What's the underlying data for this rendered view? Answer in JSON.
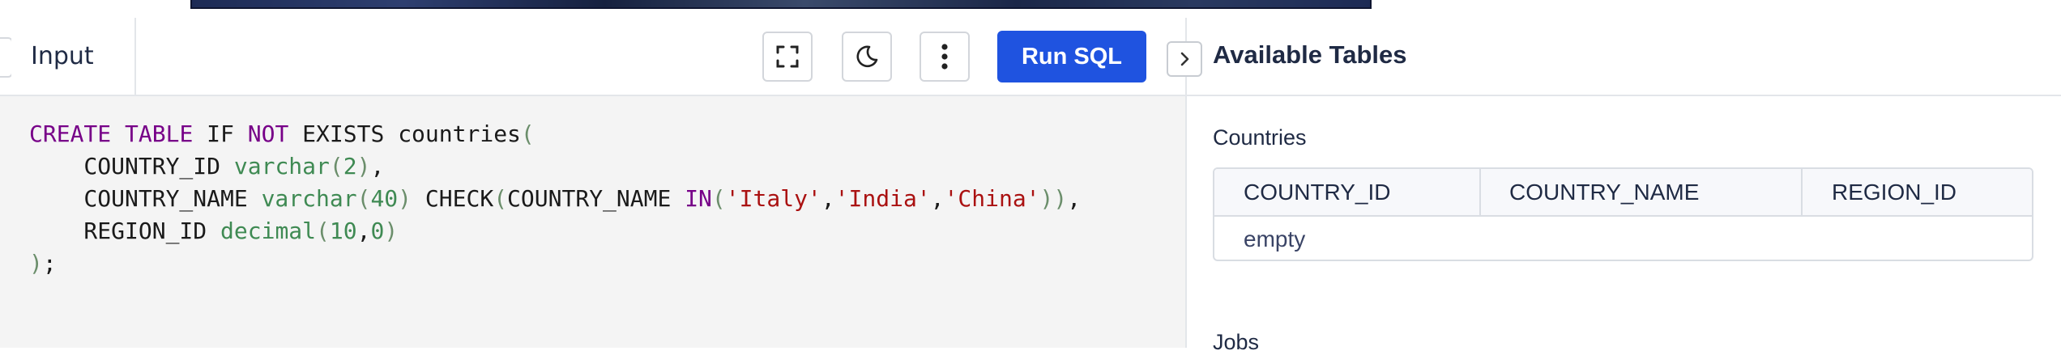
{
  "toolbar": {
    "input_tab_label": "Input",
    "run_label": "Run SQL",
    "icons": [
      "fullscreen-icon",
      "moon-icon",
      "more-vertical-icon"
    ]
  },
  "editor": {
    "lines": [
      "CREATE TABLE IF NOT EXISTS countries(",
      "    COUNTRY_ID varchar(2),",
      "    COUNTRY_NAME varchar(40) CHECK(COUNTRY_NAME IN('Italy','India','China')),",
      "    REGION_ID decimal(10,0)",
      ");"
    ]
  },
  "sidebar": {
    "title": "Available Tables",
    "tables": [
      {
        "name": "Countries",
        "columns": [
          "COUNTRY_ID",
          "COUNTRY_NAME",
          "REGION_ID"
        ],
        "rows_text": "empty"
      },
      {
        "name": "Jobs"
      }
    ]
  },
  "colors": {
    "accent": "#1f53e0",
    "keyword": "#770088",
    "type": "#3f8a53",
    "string": "#aa1111"
  }
}
